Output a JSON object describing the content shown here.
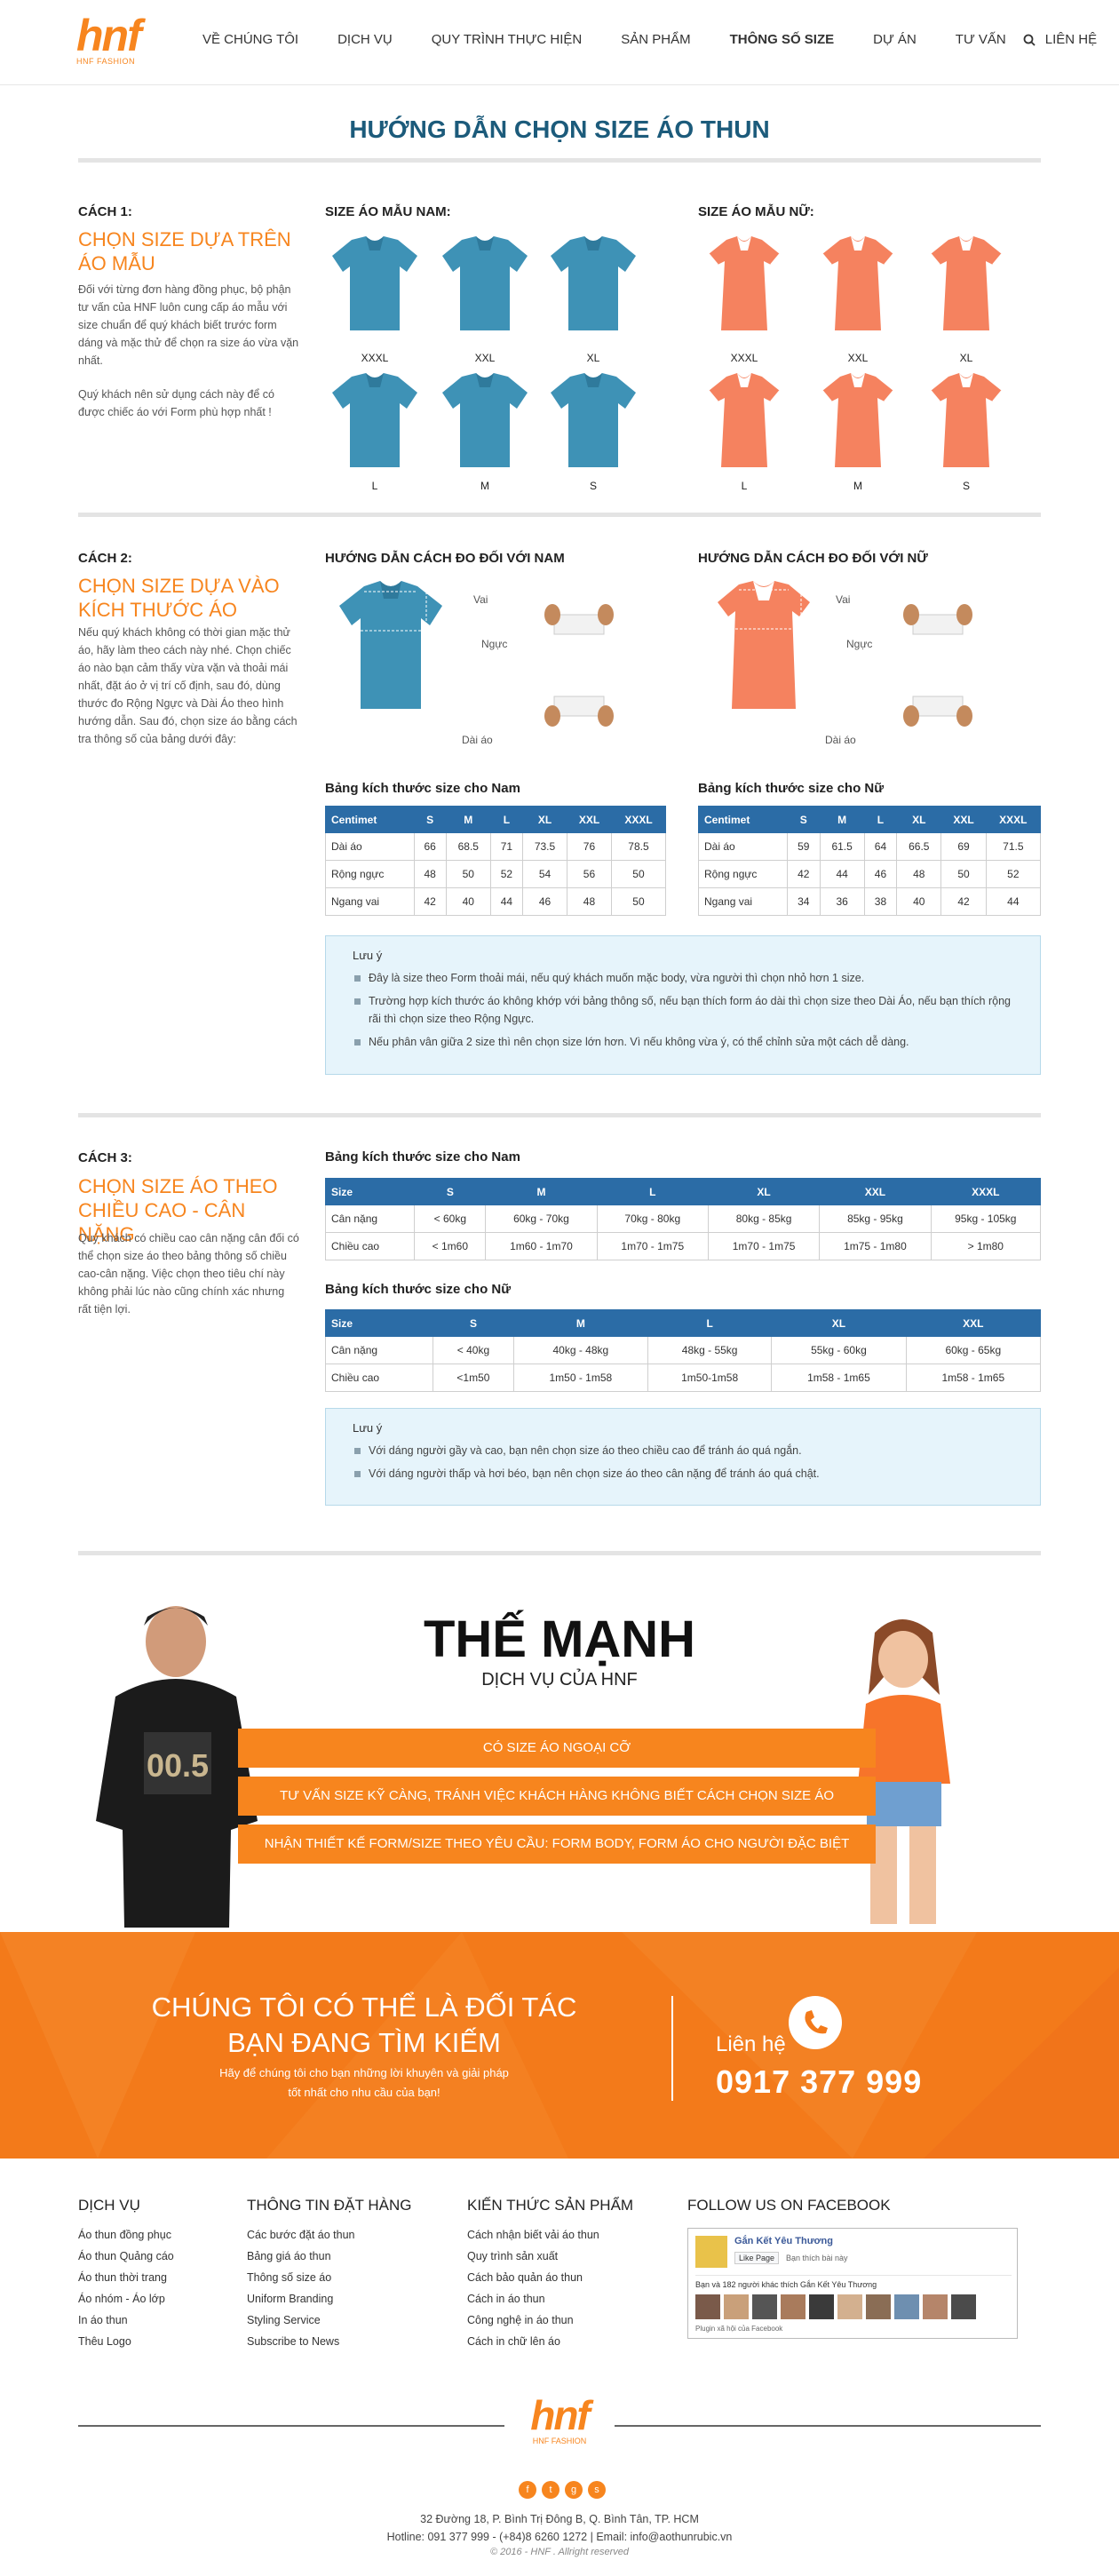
{
  "header": {
    "logo_text": "hnf",
    "logo_sub": "HNF FASHION",
    "nav": [
      "VỀ CHÚNG TÔI",
      "DỊCH VỤ",
      "QUY TRÌNH THỰC HIỆN",
      "SẢN PHẨM",
      "THÔNG SỐ SIZE",
      "DỰ ÁN",
      "TƯ VẤN",
      "LIÊN HỆ"
    ],
    "active_nav": "THÔNG SỐ SIZE"
  },
  "page_title": "HƯỚNG DẪN CHỌN SIZE ÁO THUN",
  "colors": {
    "accent": "#f7851e",
    "title": "#1c5b7b",
    "table_head": "#2b6ca6",
    "male_shirt": "#3e92b6",
    "female_shirt": "#f5825f",
    "note_bg": "#e6f4fb"
  },
  "step1": {
    "label": "CÁCH 1:",
    "title": "CHỌN SIZE DỰA TRÊN ÁO MẪU",
    "desc1": "Đối với từng đơn hàng đồng phục, bộ phận tư vấn của HNF luôn cung cấp áo mẫu với size chuẩn để quý khách biết trước form dáng và mặc thử để chọn ra size áo vừa vặn nhất.",
    "desc2": "Quý khách nên sử dụng cách này để có được chiếc áo với Form phù hợp nhất !",
    "male_heading": "SIZE ÁO MẪU NAM:",
    "female_heading": "SIZE ÁO MẪU NỮ:",
    "male_sizes": [
      "XXXL",
      "XXL",
      "XL",
      "L",
      "M",
      "S"
    ],
    "female_sizes": [
      "XXXL",
      "XXL",
      "XL",
      "L",
      "M",
      "S"
    ]
  },
  "step2": {
    "label": "CÁCH 2:",
    "title": "CHỌN SIZE DỰA VÀO KÍCH THƯỚC ÁO",
    "desc": "Nếu quý khách không có thời gian mặc thử áo, hãy làm theo cách này nhé. Chọn chiếc áo nào bạn cảm thấy vừa vặn và thoải mái nhất, đặt áo ở vị trí cố định, sau đó, dùng thước đo Rộng Ngực và Dài Áo theo hình hướng dẫn. Sau đó, chọn size áo bằng cách tra thông số của bảng dưới đây:",
    "male_heading": "HƯỚNG DẪN CÁCH ĐO ĐỐI VỚI NAM",
    "female_heading": "HƯỚNG DẪN CÁCH ĐO ĐỐI VỚI NỮ",
    "measure_labels": [
      "Vai",
      "Ngực",
      "Dài áo"
    ],
    "male_table": {
      "title": "Bảng kích thước size cho Nam",
      "head": [
        "Centimet",
        "S",
        "M",
        "L",
        "XL",
        "XXL",
        "XXXL"
      ],
      "rows": [
        [
          "Dài áo",
          "66",
          "68.5",
          "71",
          "73.5",
          "76",
          "78.5"
        ],
        [
          "Rộng ngực",
          "48",
          "50",
          "52",
          "54",
          "56",
          "50"
        ],
        [
          "Ngang vai",
          "42",
          "40",
          "44",
          "46",
          "48",
          "50"
        ]
      ]
    },
    "female_table": {
      "title": "Bảng kích thước size cho Nữ",
      "head": [
        "Centimet",
        "S",
        "M",
        "L",
        "XL",
        "XXL",
        "XXXL"
      ],
      "rows": [
        [
          "Dài áo",
          "59",
          "61.5",
          "64",
          "66.5",
          "69",
          "71.5"
        ],
        [
          "Rộng ngực",
          "42",
          "44",
          "46",
          "48",
          "50",
          "52"
        ],
        [
          "Ngang vai",
          "34",
          "36",
          "38",
          "40",
          "42",
          "44"
        ]
      ]
    },
    "note_title": "Lưu ý",
    "notes": [
      "Đây là size theo Form thoải mái, nếu quý khách muốn mặc body, vừa người thì chọn nhỏ hơn 1 size.",
      "Trường hợp kích thước áo không khớp với bảng thông số, nếu bạn thích form áo dài thì chọn size theo Dài Áo, nếu bạn thích rộng rãi thì chọn size theo Rộng Ngực.",
      "Nếu phân vân giữa 2 size thì nên chọn size lớn hơn. Vì nếu không vừa ý, có thể chỉnh sửa một cách dễ dàng."
    ]
  },
  "step3": {
    "label": "CÁCH 3:",
    "title": "CHỌN SIZE ÁO THEO CHIỀU CAO - CÂN NẶNG",
    "desc": "Quý khách có chiều cao cân nặng cân đối có thể chọn size áo theo bảng thông số chiều cao-cân nặng. Việc chọn theo tiêu chí này không phải lúc nào cũng chính xác nhưng rất tiện lợi.",
    "male_table": {
      "title": "Bảng kích thước size cho Nam",
      "head": [
        "Size",
        "S",
        "M",
        "L",
        "XL",
        "XXL",
        "XXXL"
      ],
      "rows": [
        [
          "Cân nặng",
          "< 60kg",
          "60kg - 70kg",
          "70kg - 80kg",
          "80kg - 85kg",
          "85kg - 95kg",
          "95kg - 105kg"
        ],
        [
          "Chiều cao",
          "< 1m60",
          "1m60 - 1m70",
          "1m70 - 1m75",
          "1m70 - 1m75",
          "1m75 - 1m80",
          "> 1m80"
        ]
      ]
    },
    "female_table": {
      "title": "Bảng kích thước size cho Nữ",
      "head": [
        "Size",
        "S",
        "M",
        "L",
        "XL",
        "XXL"
      ],
      "rows": [
        [
          "Cân nặng",
          "< 40kg",
          "40kg - 48kg",
          "48kg - 55kg",
          "55kg - 60kg",
          "60kg - 65kg"
        ],
        [
          "Chiều cao",
          "<1m50",
          "1m50 - 1m58",
          "1m50-1m58",
          "1m58 - 1m65",
          "1m58 - 1m65"
        ]
      ]
    },
    "note_title": "Lưu ý",
    "notes": [
      "Với dáng người gầy và cao, bạn nên chọn size áo theo chiều cao để tránh áo quá ngắn.",
      "Với dáng người thấp và hơi béo, bạn nên chọn size áo theo cân nặng để tránh áo quá chật."
    ]
  },
  "strengths": {
    "title": "THẾ MẠNH",
    "subtitle": "DỊCH VỤ CỦA HNF",
    "items": [
      "CÓ SIZE ÁO NGOẠI CỠ",
      "TƯ VẤN SIZE KỸ CÀNG, TRÁNH VIỆC KHÁCH HÀNG KHÔNG BIẾT CÁCH CHỌN SIZE ÁO",
      "NHẬN THIẾT KẾ FORM/SIZE THEO YÊU CẦU: FORM BODY, FORM ÁO CHO NGƯỜI ĐẶC BIỆT"
    ],
    "male_shirt_text": "00.5"
  },
  "banner": {
    "line1": "CHÚNG TÔI CÓ THỂ LÀ ĐỐI TÁC",
    "line2": "BẠN ĐANG TÌM KIẾM",
    "sub1": "Hãy để chúng tôi cho bạn những lời khuyên và giải pháp",
    "sub2": "tốt nhất cho nhu cầu của bạn!",
    "contact_label": "Liên hệ",
    "phone": "0917 377 999"
  },
  "footer": {
    "cols": [
      {
        "title": "DỊCH VỤ",
        "items": [
          "Áo thun đồng phục",
          "Áo thun Quảng cáo",
          "Áo thun thời trang",
          "Áo nhóm - Áo lớp",
          "In áo thun",
          "Thêu Logo"
        ]
      },
      {
        "title": "THÔNG TIN ĐẶT HÀNG",
        "items": [
          "Các bước đặt áo thun",
          "Bảng giá áo thun",
          "Thông số size áo",
          "Uniform Branding",
          "Styling Service",
          "Subscribe to News"
        ]
      },
      {
        "title": "KIẾN THỨC SẢN PHẨM",
        "items": [
          "Cách nhận biết vải áo thun",
          "Quy trình sản xuất",
          "Cách bảo quản áo thun",
          "Cách in áo thun",
          "Công nghệ in áo thun",
          "Cách in chữ lên áo"
        ]
      }
    ],
    "fb_title": "FOLLOW US ON FACEBOOK",
    "fb_page": "Gắn Kết Yêu Thương",
    "fb_like": "Like Page",
    "fb_liked": "Bạn thích bài này",
    "fb_friends": "Bạn và 182 người khác thích Gắn Kết Yêu Thương",
    "fb_plugin": "Plugin xã hội của Facebook",
    "address": "32 Đường 18, P. Bình Trị Đông B, Q. Bình Tân, TP. HCM",
    "contact": "Hotline: 091 377 999 - (+84)8 6260 1272  |  Email: info@aothunrubic.vn",
    "copyright": "© 2016 - HNF . Allright reserved",
    "social": [
      "f",
      "t",
      "g",
      "s"
    ]
  }
}
